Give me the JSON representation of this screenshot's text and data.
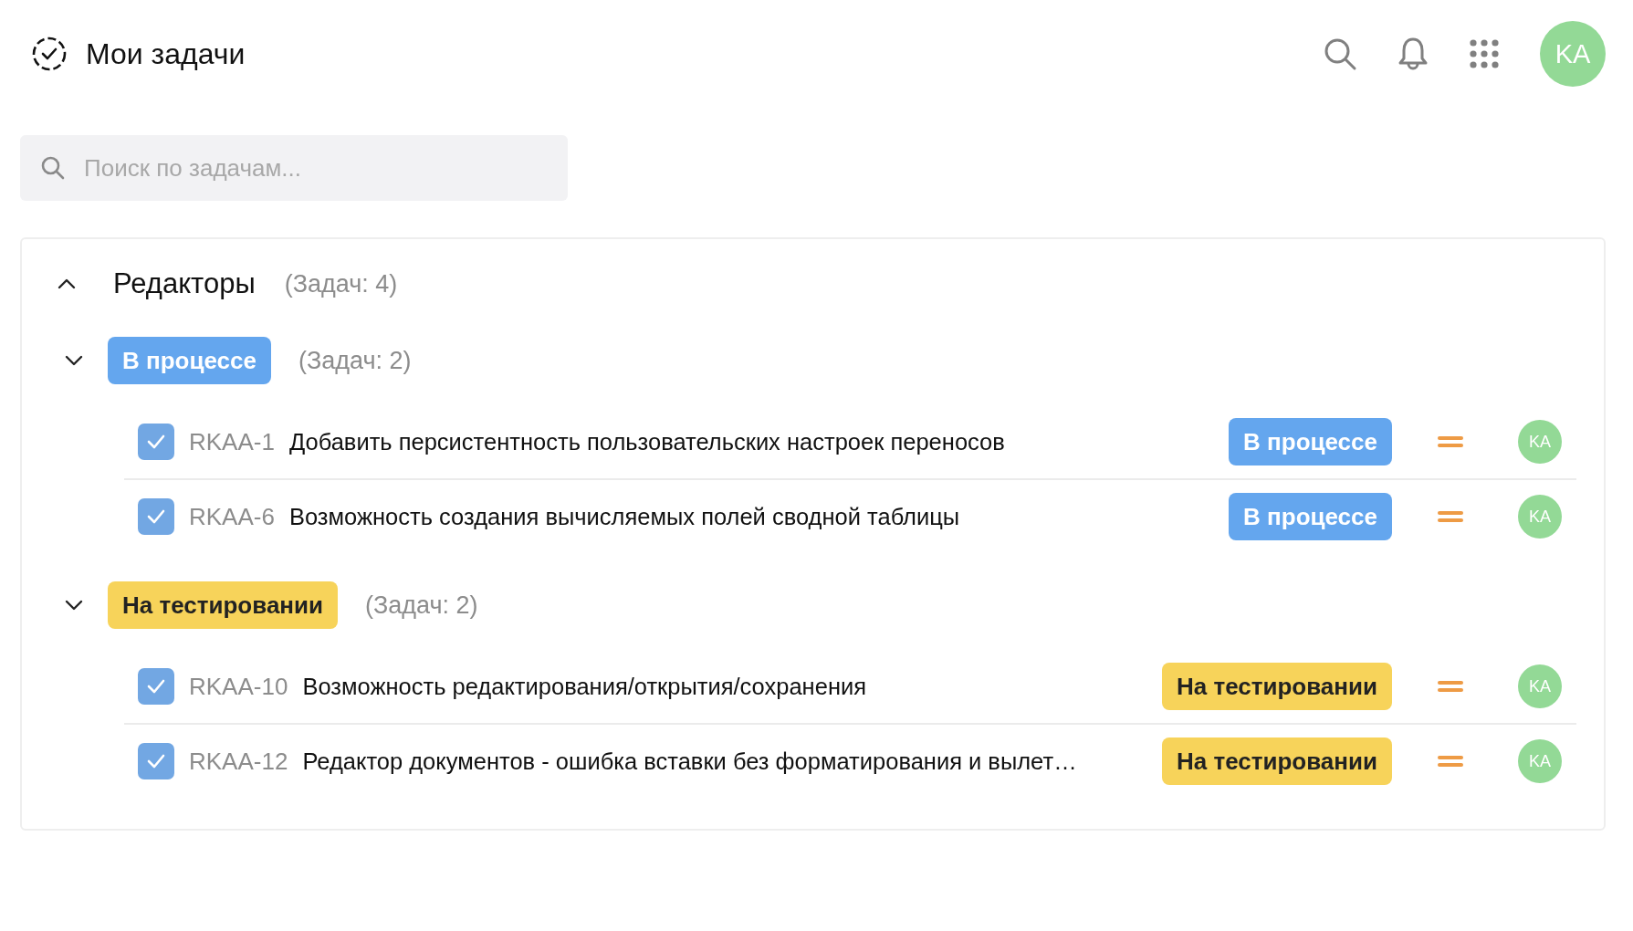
{
  "header": {
    "title": "Мои задачи",
    "avatar": "KA"
  },
  "search": {
    "placeholder": "Поиск по задачам..."
  },
  "project": {
    "name": "Редакторы",
    "count": "(Задач: 4)",
    "expanded": true,
    "groups": [
      {
        "status": "В процессе",
        "kind": "progress",
        "count": "(Задач: 2)",
        "expanded": true,
        "tasks": [
          {
            "checked": true,
            "key": "RKAA-1",
            "title": "Добавить персистентность пользовательских настроек переносов",
            "status": "В процессе",
            "kind": "progress",
            "color": "#ee9b45",
            "assignee": "KA"
          },
          {
            "checked": true,
            "key": "RKAA-6",
            "title": "Возможность создания вычисляемых полей сводной таблицы",
            "status": "В процессе",
            "kind": "progress",
            "color": "#ee9b45",
            "assignee": "KA"
          }
        ]
      },
      {
        "status": "На тестировании",
        "kind": "testing",
        "count": "(Задач: 2)",
        "expanded": true,
        "tasks": [
          {
            "checked": true,
            "key": "RKAA-10",
            "title": "Возможность редактирования/открытия/сохранения",
            "status": "На тестировании",
            "kind": "testing",
            "color": "#ee9b45",
            "assignee": "KA"
          },
          {
            "checked": true,
            "key": "RKAA-12",
            "title": "Редактор документов - ошибка вставки без форматирования и вылет…",
            "status": "На тестировании",
            "kind": "testing",
            "color": "#ee9b45",
            "assignee": "KA"
          }
        ]
      }
    ]
  }
}
